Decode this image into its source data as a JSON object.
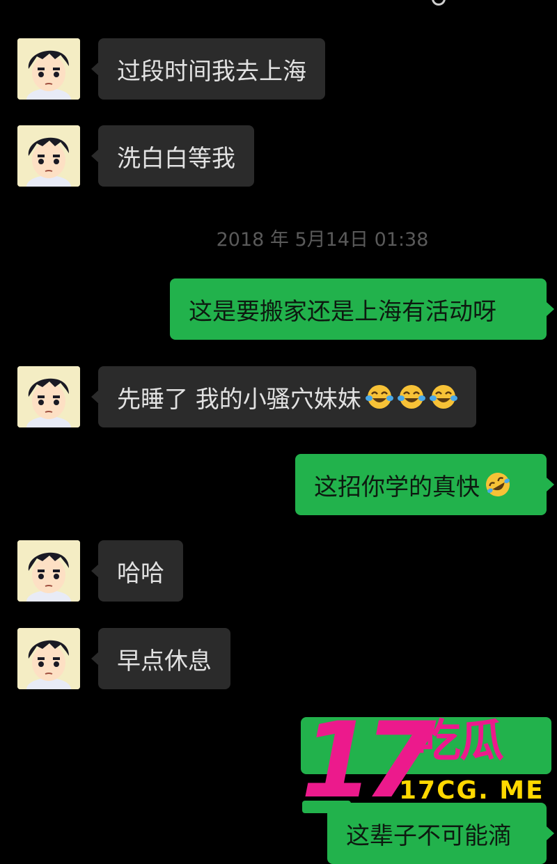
{
  "timestamp": "2018 年 5月14日 01:38",
  "messages": [
    {
      "side": "in",
      "text": "过段时间我去上海"
    },
    {
      "side": "in",
      "text": "洗白白等我"
    },
    {
      "side": "out",
      "text": "这是要搬家还是上海有活动呀"
    },
    {
      "side": "in",
      "text": "先睡了  我的小骚穴妹妹",
      "emojis": [
        "tears-of-joy-emoji",
        "tears-of-joy-emoji",
        "tears-of-joy-emoji"
      ]
    },
    {
      "side": "out",
      "text": "这招你学的真快",
      "emojis": [
        "rolling-laughing-emoji"
      ]
    },
    {
      "side": "in",
      "text": "哈哈"
    },
    {
      "side": "in",
      "text": "早点休息"
    },
    {
      "side": "out",
      "text": "这辈子不可能滴"
    }
  ],
  "watermark": {
    "number": "17",
    "chinese": "吃瓜",
    "url": "17CG. ME"
  },
  "colors": {
    "background": "#000000",
    "incoming_bubble": "#2b2b2b",
    "outgoing_bubble": "#22b24c",
    "watermark_pink": "#ec1a8c",
    "watermark_yellow": "#ffd800"
  }
}
